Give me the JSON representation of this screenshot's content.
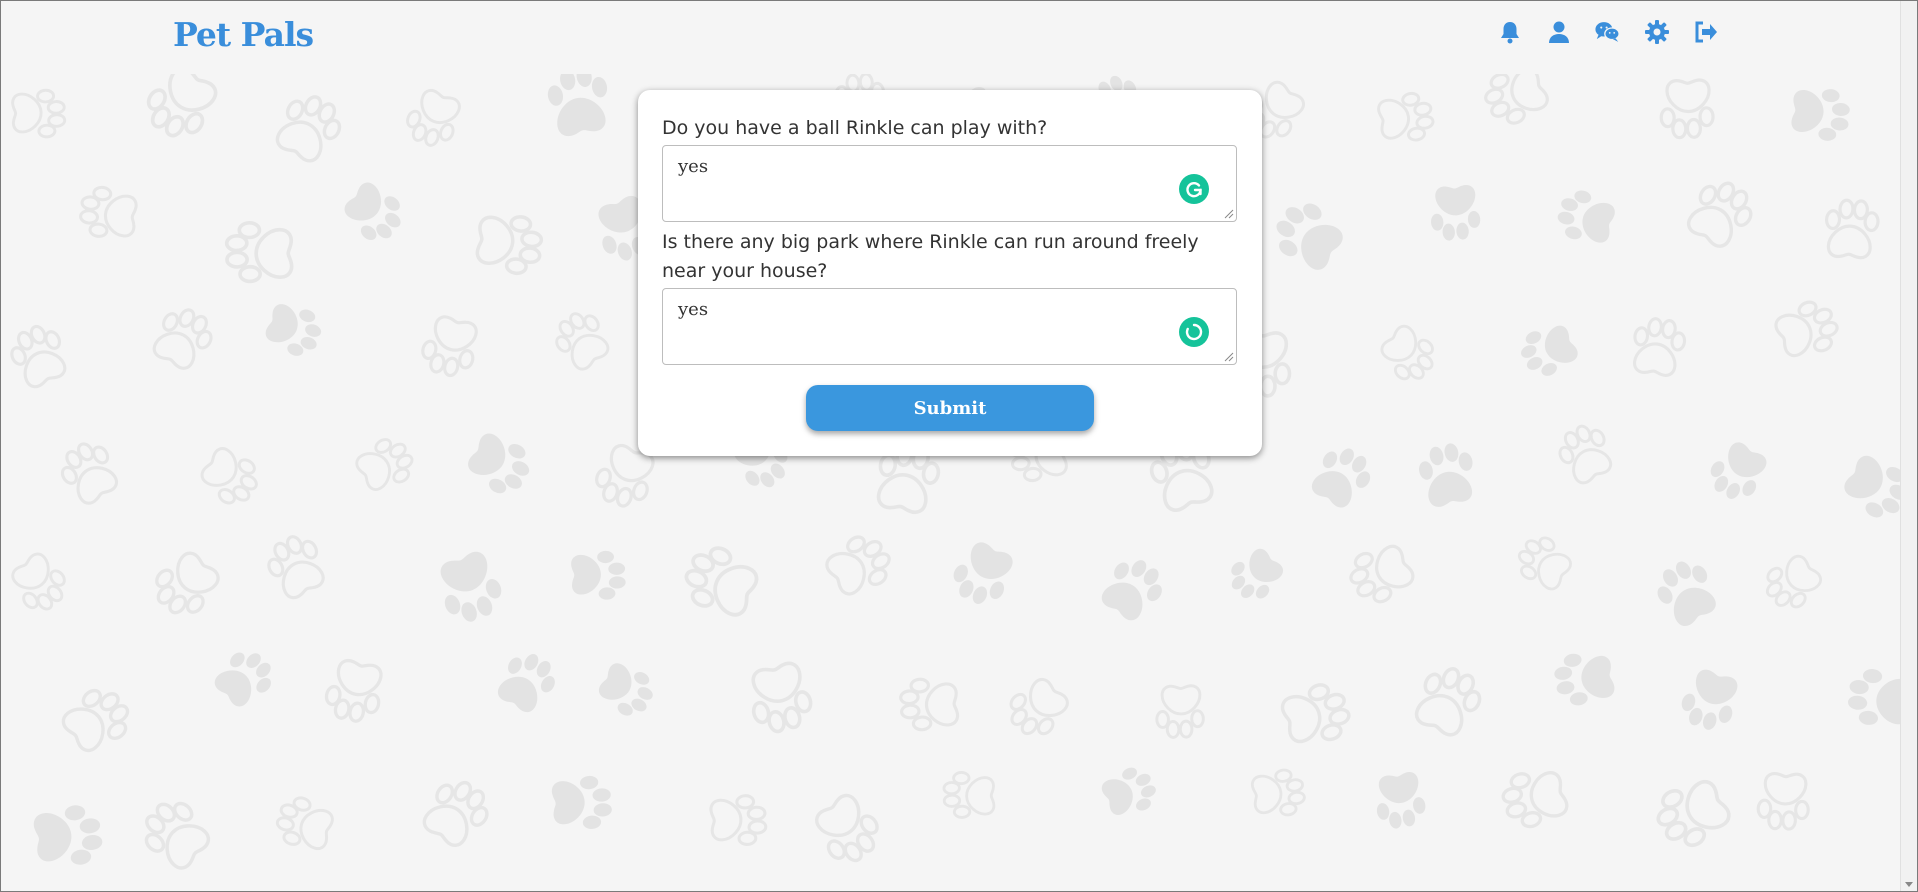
{
  "navbar": {
    "brand": "Pet Pals",
    "icons": [
      "bell-icon",
      "user-icon",
      "wechat-icon",
      "gear-icon",
      "sign-out-icon"
    ],
    "accent": "#3a8edb"
  },
  "form": {
    "questions": [
      {
        "label": "Do you have a ball Rinkle can play with?",
        "answer": "yes"
      },
      {
        "label": "Is there any big park where Rinkle can run around freely near your house?",
        "answer": "yes"
      }
    ],
    "submit_label": "Submit"
  },
  "colors": {
    "background": "#f5f5f5",
    "button": "#3a97de",
    "grammar_badge": "#15c39a"
  }
}
